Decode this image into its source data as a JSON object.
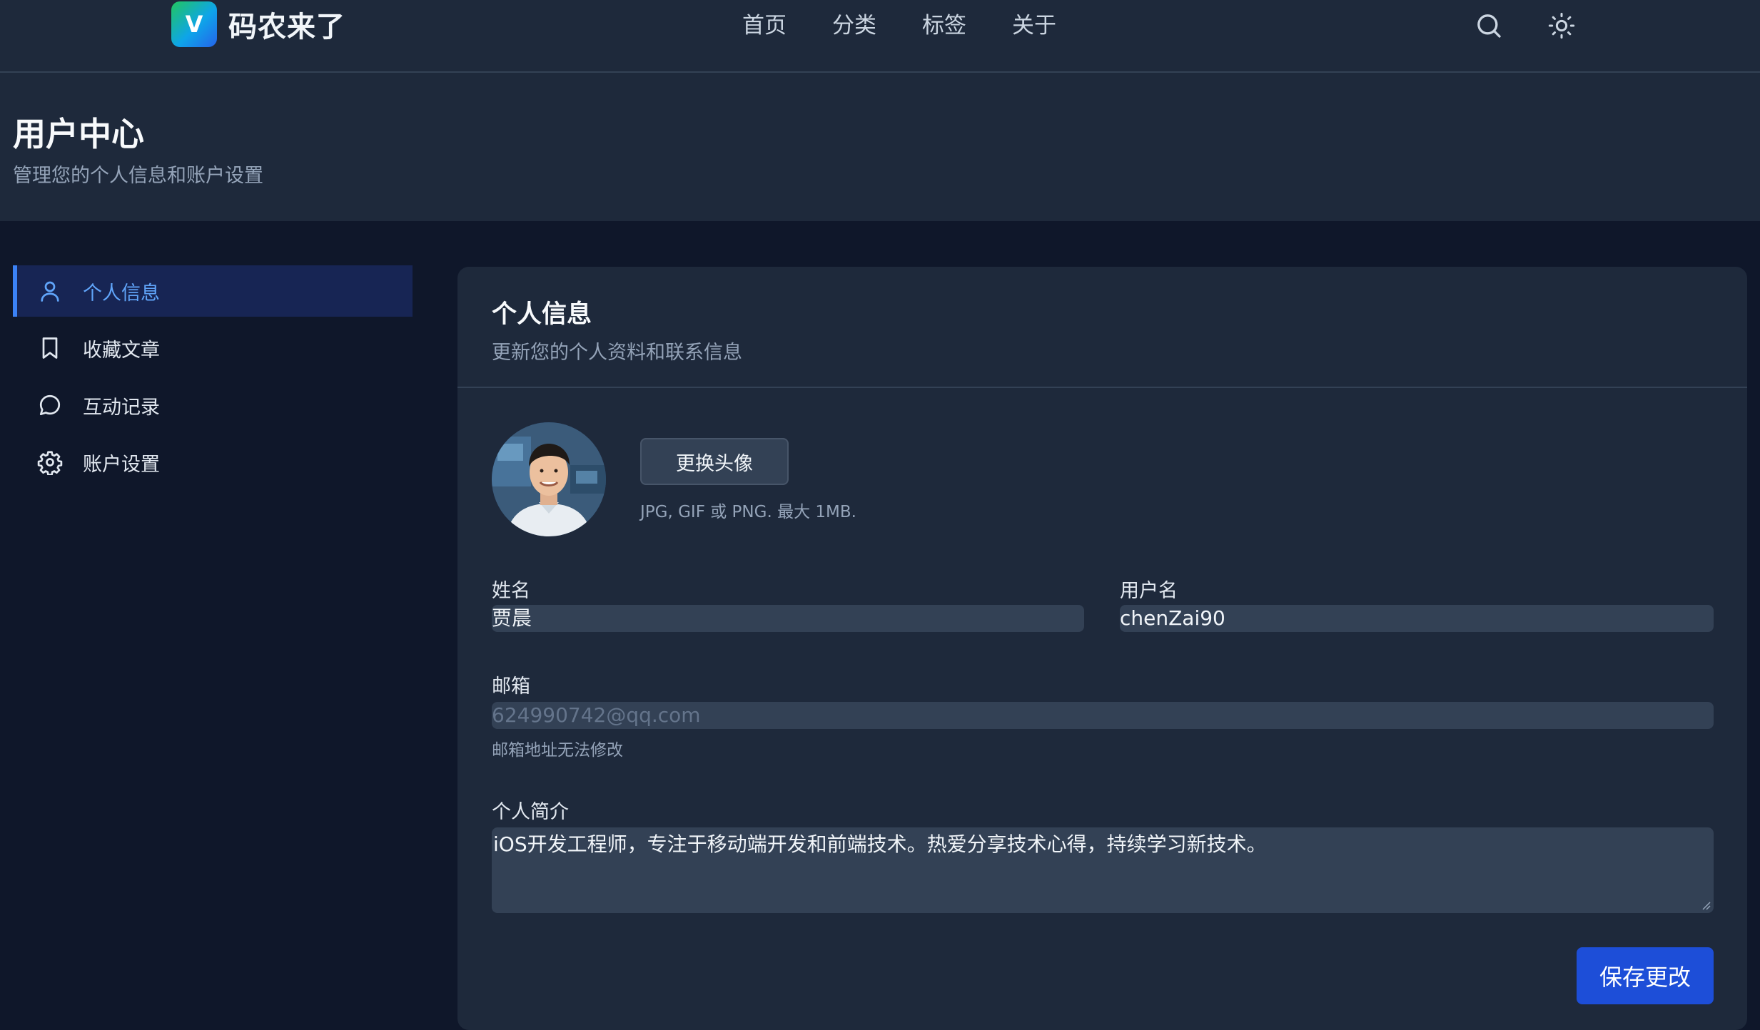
{
  "brand": {
    "badge": "V",
    "name": "码农来了"
  },
  "nav": {
    "items": [
      "首页",
      "分类",
      "标签",
      "关于"
    ]
  },
  "topbar": {
    "search_icon": "search-icon",
    "theme_icon": "sun-icon"
  },
  "header": {
    "title": "用户中心",
    "subtitle": "管理您的个人信息和账户设置"
  },
  "sidebar": {
    "items": [
      {
        "label": "个人信息",
        "icon": "user-icon",
        "active": true
      },
      {
        "label": "收藏文章",
        "icon": "bookmark-icon",
        "active": false
      },
      {
        "label": "互动记录",
        "icon": "chat-icon",
        "active": false
      },
      {
        "label": "账户设置",
        "icon": "gear-icon",
        "active": false
      }
    ]
  },
  "profile": {
    "title": "个人信息",
    "subtitle": "更新您的个人资料和联系信息",
    "change_avatar_label": "更换头像",
    "avatar_hint": "JPG, GIF 或 PNG. 最大 1MB.",
    "name_label": "姓名",
    "name_value": "贾晨",
    "username_label": "用户名",
    "username_value": "chenZai90",
    "email_label": "邮箱",
    "email_value": "624990742@qq.com",
    "email_hint": "邮箱地址无法修改",
    "bio_label": "个人简介",
    "bio_value": "iOS开发工程师，专注于移动端开发和前端技术。热爱分享技术心得，持续学习新技术。",
    "save_label": "保存更改"
  },
  "colors": {
    "accent": "#1d4ed8",
    "active_text": "#60a5fa",
    "background": "#0f172a",
    "surface": "#1e293b"
  }
}
